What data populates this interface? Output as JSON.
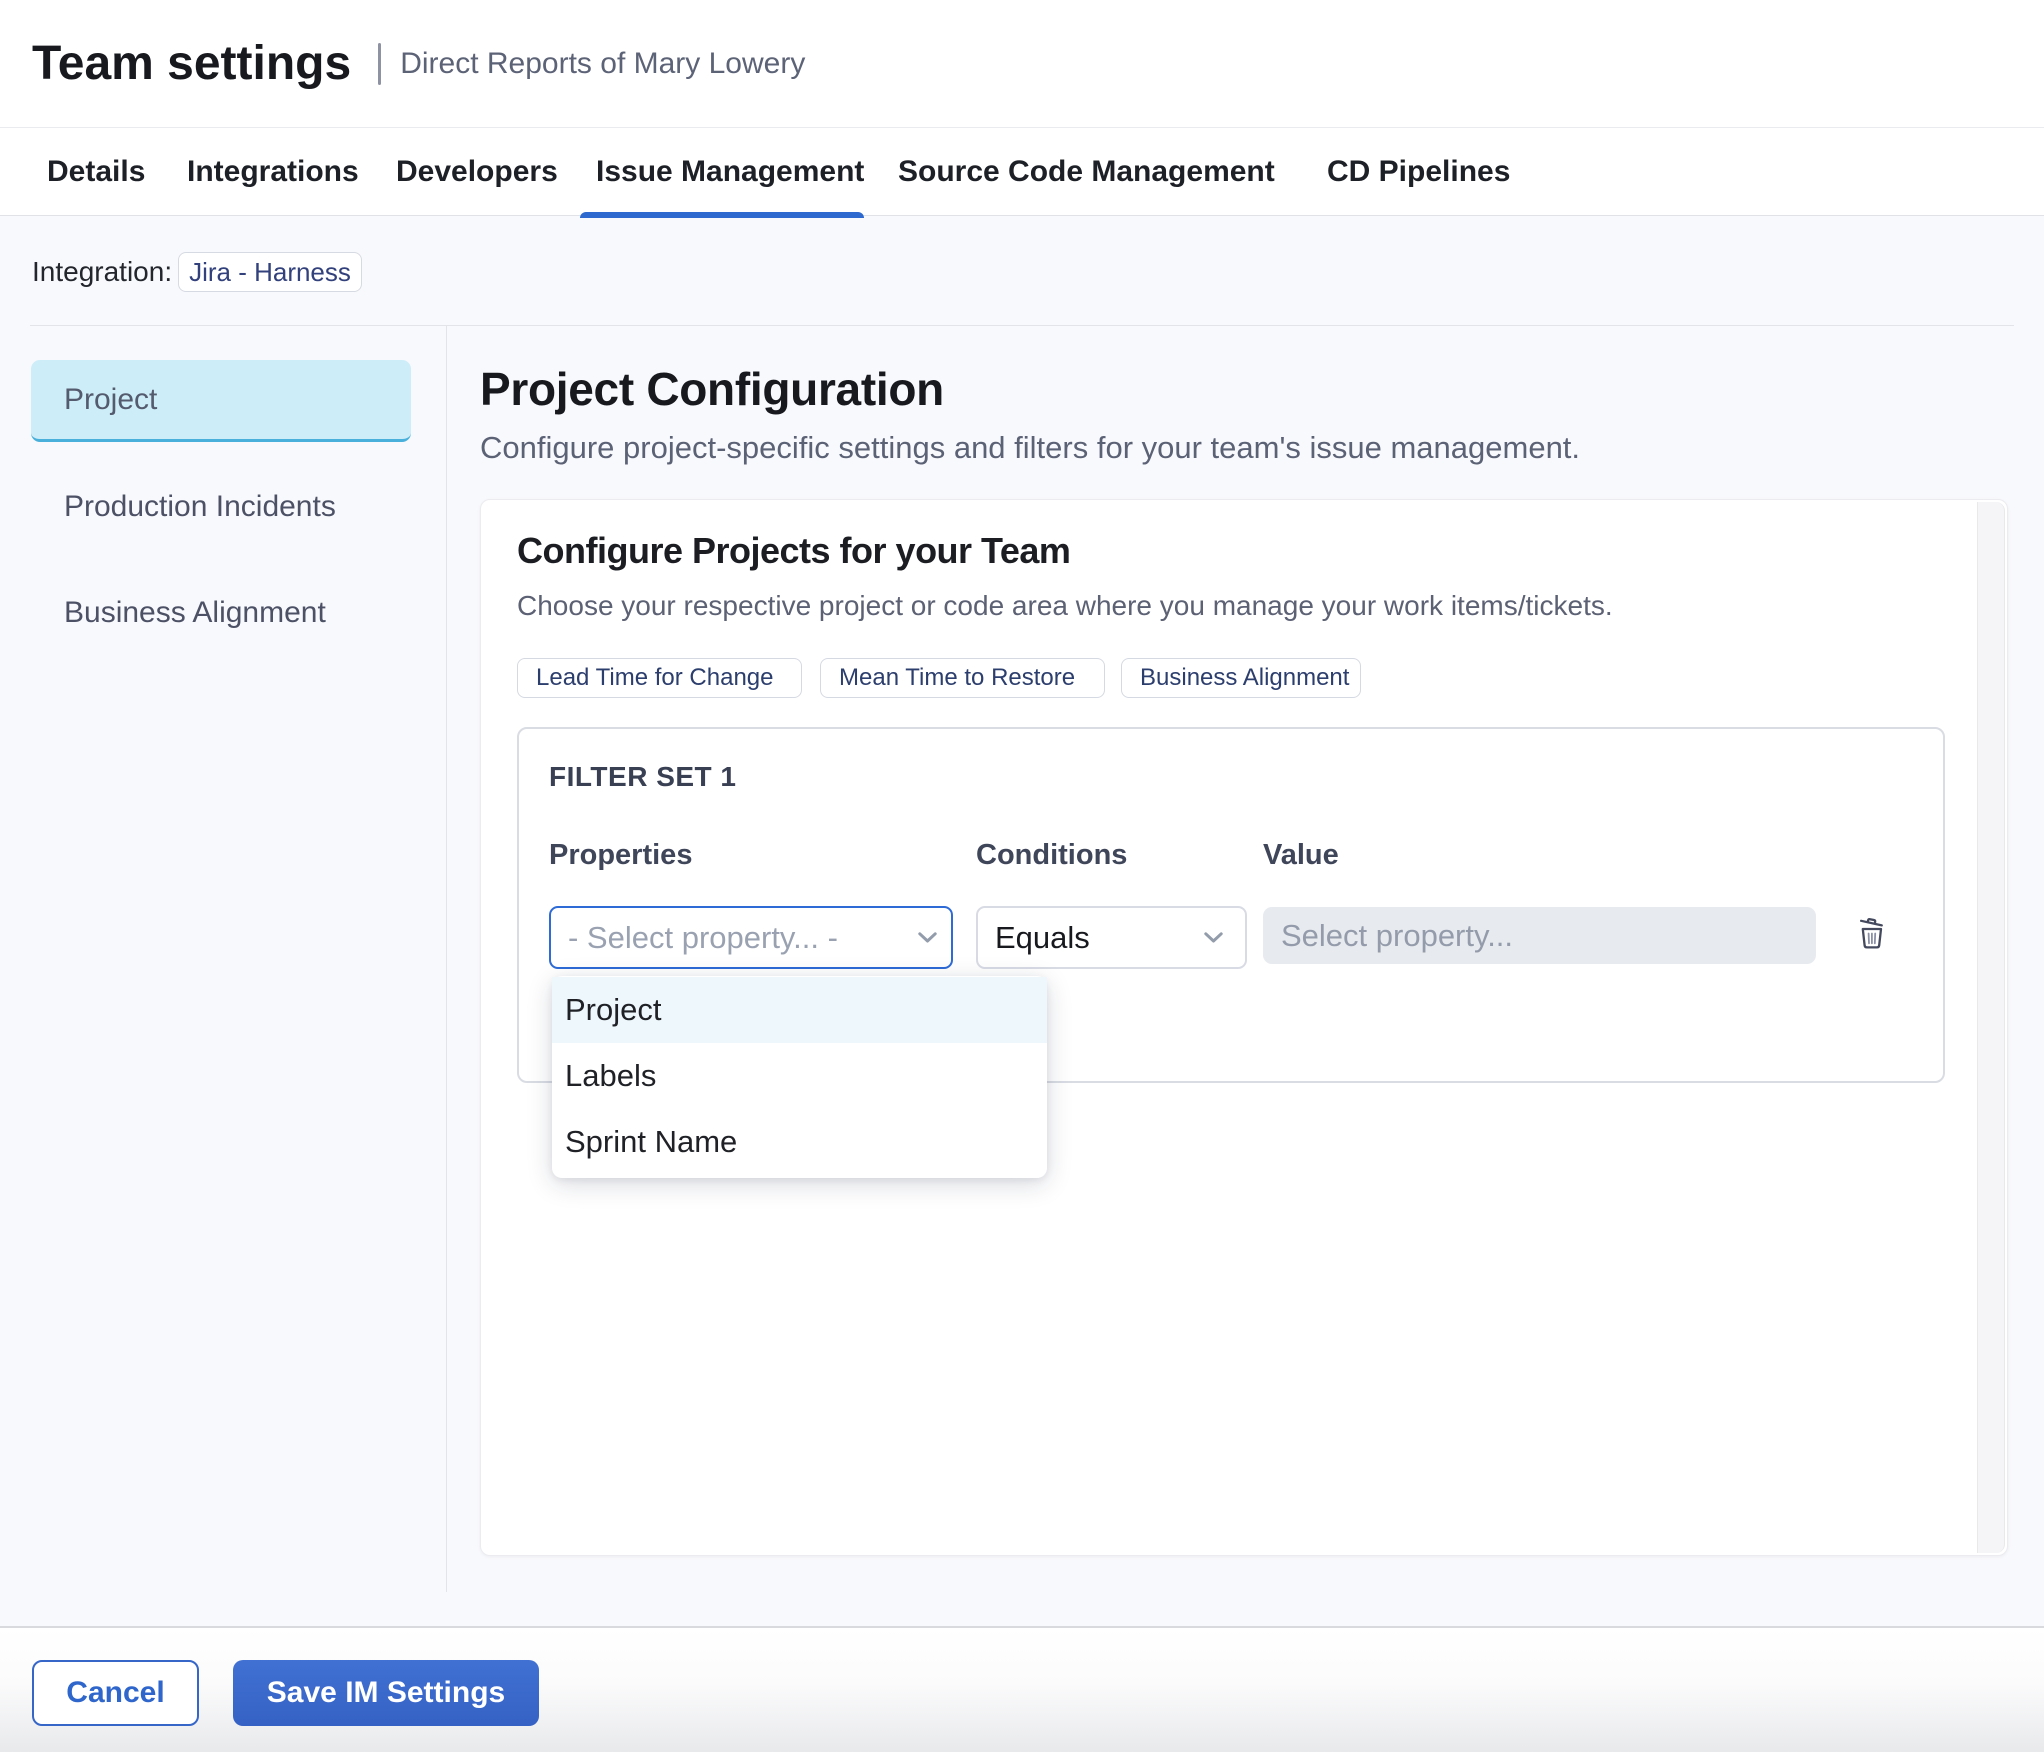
{
  "header": {
    "title": "Team settings",
    "subtitle": "Direct Reports of Mary Lowery"
  },
  "tabs": [
    {
      "label": "Details",
      "active": false
    },
    {
      "label": "Integrations",
      "active": false
    },
    {
      "label": "Developers",
      "active": false
    },
    {
      "label": "Issue Management",
      "active": true
    },
    {
      "label": "Source Code Management",
      "active": false
    },
    {
      "label": "CD Pipelines",
      "active": false
    }
  ],
  "integration": {
    "label": "Integration:",
    "chip": "Jira - Harness"
  },
  "sidebar": {
    "items": [
      {
        "label": "Project",
        "active": true
      },
      {
        "label": "Production Incidents",
        "active": false
      },
      {
        "label": "Business Alignment",
        "active": false
      }
    ]
  },
  "main": {
    "title": "Project Configuration",
    "subtitle": "Configure project-specific settings and filters for your team's issue management.",
    "card": {
      "title": "Configure Projects for your Team",
      "subtitle": "Choose your respective project or code area where you manage your work items/tickets.",
      "chips": [
        "Lead Time for Change",
        "Mean Time to Restore",
        "Business Alignment"
      ],
      "filter_set": {
        "title": "FILTER SET 1",
        "columns": [
          "Properties",
          "Conditions",
          "Value"
        ],
        "property_placeholder": "- Select property... -",
        "condition_value": "Equals",
        "value_placeholder": "Select property...",
        "dropdown_options": [
          "Project",
          "Labels",
          "Sprint Name"
        ],
        "highlighted_option": "Project"
      }
    }
  },
  "footer": {
    "cancel_label": "Cancel",
    "save_label": "Save IM Settings"
  },
  "colors": {
    "accent_blue": "#2e69cf",
    "active_nav_bg": "#cdedf9",
    "active_nav_border": "#49b0dc",
    "save_button": "#3c6bcd"
  }
}
